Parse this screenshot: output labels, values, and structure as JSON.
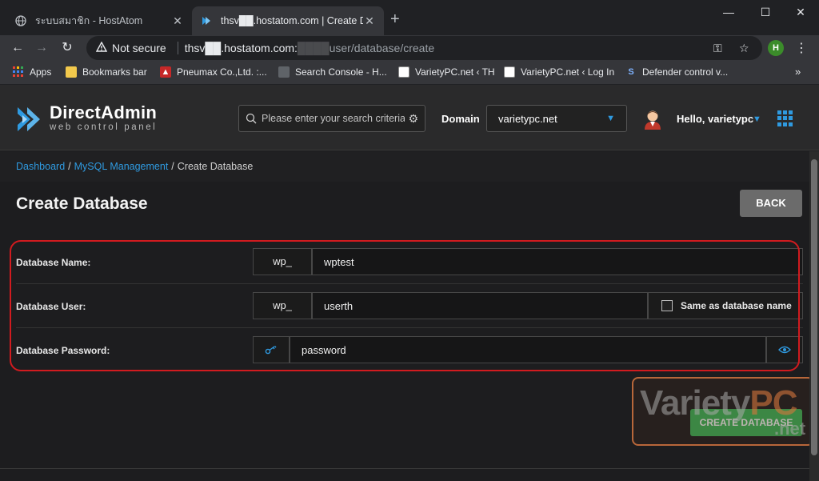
{
  "browser": {
    "tabs": [
      {
        "title": "ระบบสมาชิก - HostAtom",
        "active": false
      },
      {
        "title": "thsv██.hostatom.com | Create Da",
        "active": true
      }
    ],
    "address": {
      "security": "Not secure",
      "host": "thsv██.hostatom.com:",
      "port_mask": "████",
      "path": "user/database/create"
    },
    "profile_initial": "H",
    "bookmarks": [
      {
        "label": "Apps",
        "icon": "apps-icon"
      },
      {
        "label": "Bookmarks bar",
        "icon": "folder-icon"
      },
      {
        "label": "Pneumax Co.,Ltd. :...",
        "icon": "pneumax-icon"
      },
      {
        "label": "Search Console - H...",
        "icon": "search-console-icon"
      },
      {
        "label": "VarietyPC.net ‹ TH",
        "icon": "varietypc-icon"
      },
      {
        "label": "VarietyPC.net ‹ Log In",
        "icon": "varietypc-icon"
      },
      {
        "label": "Defender control v...",
        "icon": "defender-icon"
      }
    ],
    "bookmarks_more": "»"
  },
  "header": {
    "logo_title": "DirectAdmin",
    "logo_subtitle": "web control panel",
    "search_placeholder": "Please enter your search criteria",
    "domain_label": "Domain",
    "domain_value": "varietypc.net",
    "hello_text": "Hello, varietypc"
  },
  "breadcrumb": {
    "items": [
      "Dashboard",
      "MySQL Management",
      "Create Database"
    ],
    "separator": "/"
  },
  "page": {
    "title": "Create Database",
    "back_label": "BACK",
    "create_label": "CREATE DATABASE"
  },
  "form": {
    "db_name_label": "Database Name:",
    "db_name_prefix": "wp_",
    "db_name_value": "wptest",
    "db_user_label": "Database User:",
    "db_user_prefix": "wp_",
    "db_user_value": "userth",
    "same_as_label": "Same as database name",
    "same_as_checked": false,
    "db_password_label": "Database Password:",
    "db_password_value": "password"
  },
  "watermark": {
    "main": "Variety",
    "accent": "PC",
    "suffix": ".net"
  },
  "colors": {
    "accent_blue": "#2f9ae0",
    "create_green": "#3dba5a",
    "highlight_red": "#d11b1f"
  }
}
